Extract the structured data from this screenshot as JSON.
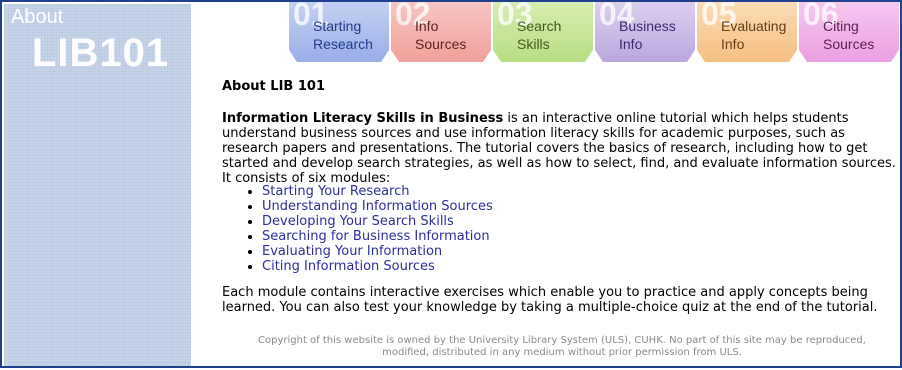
{
  "sidebar": {
    "small_text": "About",
    "big_text": "LIB101"
  },
  "tabs": [
    {
      "number": "01",
      "line1": "Starting",
      "line2": "Research"
    },
    {
      "number": "02",
      "line1": "Info",
      "line2": "Sources"
    },
    {
      "number": "03",
      "line1": "Search",
      "line2": "Skills"
    },
    {
      "number": "04",
      "line1": "Business",
      "line2": "Info"
    },
    {
      "number": "05",
      "line1": "Evaluating",
      "line2": "Info"
    },
    {
      "number": "06",
      "line1": "Citing",
      "line2": "Sources"
    }
  ],
  "main": {
    "title": "About LIB 101",
    "intro_bold": "Information Literacy Skills in Business",
    "intro_rest": " is an interactive online tutorial which helps students understand business sources and use information literacy skills for academic purposes, such as research papers and presentations. The tutorial covers the basics of research, including how to get started and develop search strategies, as well as how to select, find, and evaluate information sources. It consists of six modules:",
    "modules": [
      "Starting Your Research",
      "Understanding Information Sources",
      "Developing Your Search Skills",
      "Searching for Business Information",
      "Evaluating Your Information",
      "Citing Information Sources"
    ],
    "closing": "Each module contains interactive exercises which enable you to practice and apply concepts being learned. You can also test your knowledge by taking a multiple-choice quiz at the end of the tutorial."
  },
  "footer": {
    "line1": "Copyright of this website is owned by the University Library System (ULS), CUHK. No part of this site may be reproduced,",
    "line2": "modified, distributed in any medium without prior permission from ULS."
  }
}
